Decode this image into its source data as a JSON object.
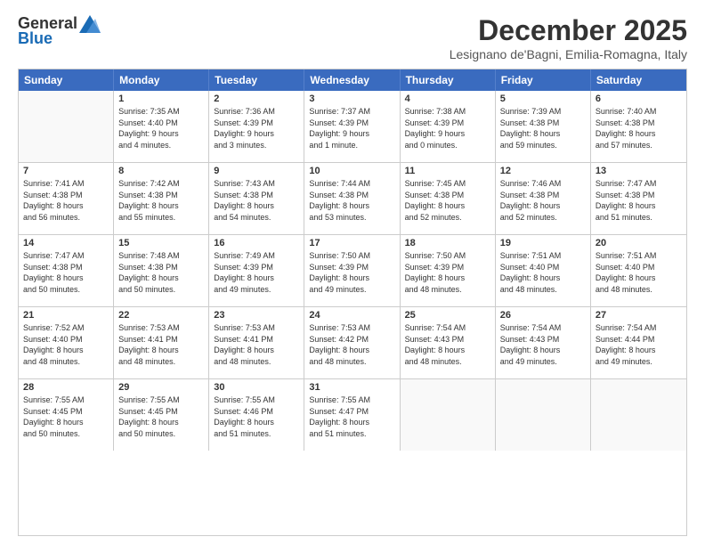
{
  "logo": {
    "general": "General",
    "blue": "Blue"
  },
  "title": "December 2025",
  "subtitle": "Lesignano de'Bagni, Emilia-Romagna, Italy",
  "header_days": [
    "Sunday",
    "Monday",
    "Tuesday",
    "Wednesday",
    "Thursday",
    "Friday",
    "Saturday"
  ],
  "weeks": [
    [
      {
        "day": "",
        "lines": []
      },
      {
        "day": "1",
        "lines": [
          "Sunrise: 7:35 AM",
          "Sunset: 4:40 PM",
          "Daylight: 9 hours",
          "and 4 minutes."
        ]
      },
      {
        "day": "2",
        "lines": [
          "Sunrise: 7:36 AM",
          "Sunset: 4:39 PM",
          "Daylight: 9 hours",
          "and 3 minutes."
        ]
      },
      {
        "day": "3",
        "lines": [
          "Sunrise: 7:37 AM",
          "Sunset: 4:39 PM",
          "Daylight: 9 hours",
          "and 1 minute."
        ]
      },
      {
        "day": "4",
        "lines": [
          "Sunrise: 7:38 AM",
          "Sunset: 4:39 PM",
          "Daylight: 9 hours",
          "and 0 minutes."
        ]
      },
      {
        "day": "5",
        "lines": [
          "Sunrise: 7:39 AM",
          "Sunset: 4:38 PM",
          "Daylight: 8 hours",
          "and 59 minutes."
        ]
      },
      {
        "day": "6",
        "lines": [
          "Sunrise: 7:40 AM",
          "Sunset: 4:38 PM",
          "Daylight: 8 hours",
          "and 57 minutes."
        ]
      }
    ],
    [
      {
        "day": "7",
        "lines": [
          "Sunrise: 7:41 AM",
          "Sunset: 4:38 PM",
          "Daylight: 8 hours",
          "and 56 minutes."
        ]
      },
      {
        "day": "8",
        "lines": [
          "Sunrise: 7:42 AM",
          "Sunset: 4:38 PM",
          "Daylight: 8 hours",
          "and 55 minutes."
        ]
      },
      {
        "day": "9",
        "lines": [
          "Sunrise: 7:43 AM",
          "Sunset: 4:38 PM",
          "Daylight: 8 hours",
          "and 54 minutes."
        ]
      },
      {
        "day": "10",
        "lines": [
          "Sunrise: 7:44 AM",
          "Sunset: 4:38 PM",
          "Daylight: 8 hours",
          "and 53 minutes."
        ]
      },
      {
        "day": "11",
        "lines": [
          "Sunrise: 7:45 AM",
          "Sunset: 4:38 PM",
          "Daylight: 8 hours",
          "and 52 minutes."
        ]
      },
      {
        "day": "12",
        "lines": [
          "Sunrise: 7:46 AM",
          "Sunset: 4:38 PM",
          "Daylight: 8 hours",
          "and 52 minutes."
        ]
      },
      {
        "day": "13",
        "lines": [
          "Sunrise: 7:47 AM",
          "Sunset: 4:38 PM",
          "Daylight: 8 hours",
          "and 51 minutes."
        ]
      }
    ],
    [
      {
        "day": "14",
        "lines": [
          "Sunrise: 7:47 AM",
          "Sunset: 4:38 PM",
          "Daylight: 8 hours",
          "and 50 minutes."
        ]
      },
      {
        "day": "15",
        "lines": [
          "Sunrise: 7:48 AM",
          "Sunset: 4:38 PM",
          "Daylight: 8 hours",
          "and 50 minutes."
        ]
      },
      {
        "day": "16",
        "lines": [
          "Sunrise: 7:49 AM",
          "Sunset: 4:39 PM",
          "Daylight: 8 hours",
          "and 49 minutes."
        ]
      },
      {
        "day": "17",
        "lines": [
          "Sunrise: 7:50 AM",
          "Sunset: 4:39 PM",
          "Daylight: 8 hours",
          "and 49 minutes."
        ]
      },
      {
        "day": "18",
        "lines": [
          "Sunrise: 7:50 AM",
          "Sunset: 4:39 PM",
          "Daylight: 8 hours",
          "and 48 minutes."
        ]
      },
      {
        "day": "19",
        "lines": [
          "Sunrise: 7:51 AM",
          "Sunset: 4:40 PM",
          "Daylight: 8 hours",
          "and 48 minutes."
        ]
      },
      {
        "day": "20",
        "lines": [
          "Sunrise: 7:51 AM",
          "Sunset: 4:40 PM",
          "Daylight: 8 hours",
          "and 48 minutes."
        ]
      }
    ],
    [
      {
        "day": "21",
        "lines": [
          "Sunrise: 7:52 AM",
          "Sunset: 4:40 PM",
          "Daylight: 8 hours",
          "and 48 minutes."
        ]
      },
      {
        "day": "22",
        "lines": [
          "Sunrise: 7:53 AM",
          "Sunset: 4:41 PM",
          "Daylight: 8 hours",
          "and 48 minutes."
        ]
      },
      {
        "day": "23",
        "lines": [
          "Sunrise: 7:53 AM",
          "Sunset: 4:41 PM",
          "Daylight: 8 hours",
          "and 48 minutes."
        ]
      },
      {
        "day": "24",
        "lines": [
          "Sunrise: 7:53 AM",
          "Sunset: 4:42 PM",
          "Daylight: 8 hours",
          "and 48 minutes."
        ]
      },
      {
        "day": "25",
        "lines": [
          "Sunrise: 7:54 AM",
          "Sunset: 4:43 PM",
          "Daylight: 8 hours",
          "and 48 minutes."
        ]
      },
      {
        "day": "26",
        "lines": [
          "Sunrise: 7:54 AM",
          "Sunset: 4:43 PM",
          "Daylight: 8 hours",
          "and 49 minutes."
        ]
      },
      {
        "day": "27",
        "lines": [
          "Sunrise: 7:54 AM",
          "Sunset: 4:44 PM",
          "Daylight: 8 hours",
          "and 49 minutes."
        ]
      }
    ],
    [
      {
        "day": "28",
        "lines": [
          "Sunrise: 7:55 AM",
          "Sunset: 4:45 PM",
          "Daylight: 8 hours",
          "and 50 minutes."
        ]
      },
      {
        "day": "29",
        "lines": [
          "Sunrise: 7:55 AM",
          "Sunset: 4:45 PM",
          "Daylight: 8 hours",
          "and 50 minutes."
        ]
      },
      {
        "day": "30",
        "lines": [
          "Sunrise: 7:55 AM",
          "Sunset: 4:46 PM",
          "Daylight: 8 hours",
          "and 51 minutes."
        ]
      },
      {
        "day": "31",
        "lines": [
          "Sunrise: 7:55 AM",
          "Sunset: 4:47 PM",
          "Daylight: 8 hours",
          "and 51 minutes."
        ]
      },
      {
        "day": "",
        "lines": []
      },
      {
        "day": "",
        "lines": []
      },
      {
        "day": "",
        "lines": []
      }
    ]
  ]
}
